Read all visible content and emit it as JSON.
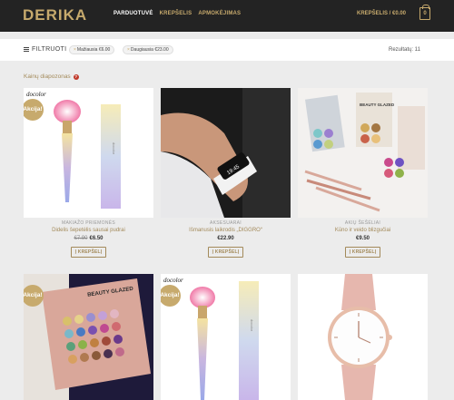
{
  "header": {
    "logo": "DERIKA",
    "nav": [
      "PARDUOTUVĖ",
      "KREPŠELIS",
      "APMOKĖJIMAS"
    ],
    "cart_link": "KREPŠELIS / €0.00",
    "cart_count": "0"
  },
  "filterbar": {
    "filter_label": "FILTRUOTI",
    "chips": [
      "Mažiausia €6.00",
      "Daugiausia €23.00"
    ],
    "results": "Rezultatų: 11"
  },
  "price_range_label": "Kainų diapozonas",
  "sale_badge": "Akcija!",
  "products": [
    {
      "category": "MAKIAŽO PRIEMONĖS",
      "name": "Didelis šepetėlis sausai pudrai",
      "old_price": "€7.90",
      "price": "€6.50",
      "button": "Į KREPŠELĮ",
      "sale": true
    },
    {
      "category": "AKSESUARAI",
      "name": "Išmanusis laikrodis „DIGGRO“",
      "old_price": "",
      "price": "€22.90",
      "button": "Į KREPŠELĮ",
      "sale": false
    },
    {
      "category": "AKIŲ ŠEŠĖLIAI",
      "name": "Kūno ir veido blizgučiai",
      "old_price": "",
      "price": "€9.50",
      "button": "Į KREPŠELĮ",
      "sale": false
    },
    {
      "category": "",
      "name": "",
      "old_price": "",
      "price": "",
      "button": "",
      "sale": true
    },
    {
      "category": "",
      "name": "",
      "old_price": "",
      "price": "",
      "button": "",
      "sale": true
    },
    {
      "category": "",
      "name": "",
      "old_price": "",
      "price": "",
      "button": "",
      "sale": false
    }
  ],
  "image_text": {
    "docolor": "docolor",
    "beauty_glazed": "BEAUTY GLAZED"
  },
  "colors": {
    "accent": "#c7aa6d",
    "header_bg": "#232323"
  }
}
